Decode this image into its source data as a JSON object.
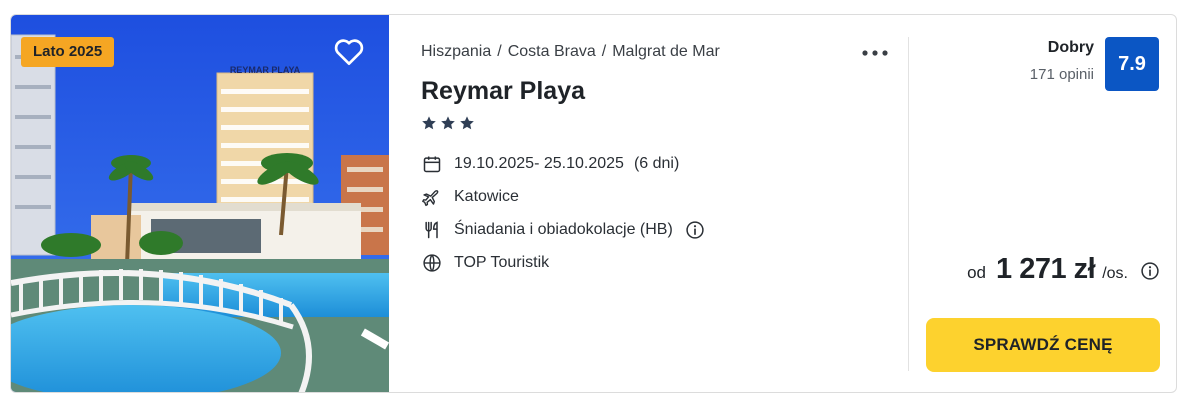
{
  "offer": {
    "badge": "Lato 2025",
    "breadcrumb": [
      "Hiszpania",
      "Costa Brava",
      "Malgrat de Mar"
    ],
    "breadcrumb_separator": "/",
    "hotel_name": "Reymar Playa",
    "star_rating": 3,
    "dates": "19.10.2025- 25.10.2025",
    "duration": "(6 dni)",
    "departure_airport": "Katowice",
    "board": "Śniadania i obiadokolacje (HB)",
    "operator": "TOP Touristik",
    "hotel_sign_text": "REYMAR PLAYA"
  },
  "rating": {
    "label": "Dobry",
    "count": "171 opinii",
    "score": "7.9",
    "color": "#0b56c4"
  },
  "price": {
    "prefix": "od",
    "amount": "1 271 zł",
    "unit": "/os."
  },
  "cta": {
    "label": "SPRAWDŹ CENĘ",
    "color": "#fdd22e"
  },
  "icons": {
    "favorite": "heart-outline-icon",
    "more": "more-horizontal-icon",
    "star": "star-icon",
    "dates": "calendar-icon",
    "airport": "airplane-icon",
    "board": "fork-knife-icon",
    "operator": "globe-icon",
    "info": "info-circle-icon"
  },
  "colors": {
    "badge": "#f5a623"
  }
}
